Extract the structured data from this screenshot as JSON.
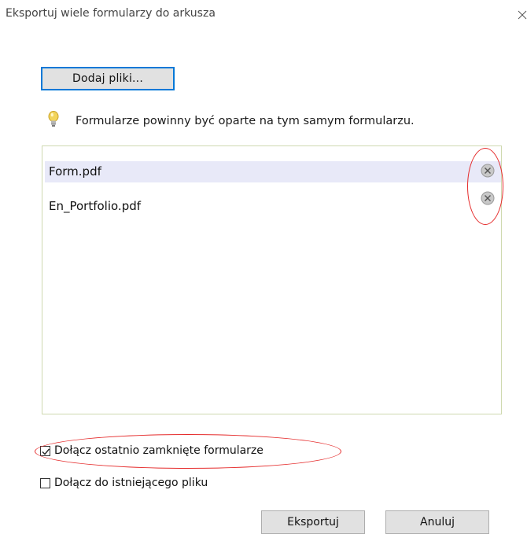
{
  "window": {
    "title": "Eksportuj wiele formularzy do arkusza"
  },
  "toolbar": {
    "add_files_label": "Dodaj pliki..."
  },
  "hint": {
    "text": "Formularze powinny być oparte na tym samym formularzu.",
    "icon": "lightbulb-icon"
  },
  "files": [
    {
      "name": "Form.pdf",
      "selected": true
    },
    {
      "name": "En_Portfolio.pdf",
      "selected": false
    }
  ],
  "options": {
    "include_recent": {
      "label": "Dołącz ostatnio zamknięte formularze",
      "checked": true
    },
    "append_existing": {
      "label": "Dołącz do istniejącego pliku",
      "checked": false
    }
  },
  "actions": {
    "export_label": "Eksportuj",
    "cancel_label": "Anuluj"
  },
  "colors": {
    "accent": "#0078d7",
    "annotation": "#e52a2a",
    "selection": "#e8e9f8"
  }
}
